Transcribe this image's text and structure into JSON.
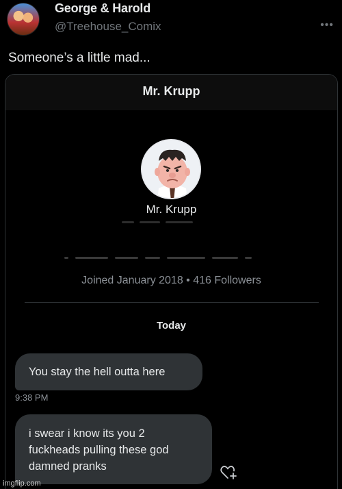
{
  "tweet": {
    "author_name": "George & Harold",
    "handle": "@Treehouse_Comix",
    "more_icon": "more-horizontal-icon",
    "text": "Someone’s a little mad..."
  },
  "card": {
    "title": "Mr. Krupp",
    "profile_name": "Mr. Krupp",
    "joined": "Joined January 2018 • 416 Followers",
    "date_header": "Today",
    "messages": [
      {
        "text": "You stay the hell outta here",
        "timestamp": "9:38 PM"
      },
      {
        "lines": [
          "i swear i know its you 2",
          "fuckheads pulling these god",
          "damned pranks"
        ]
      }
    ],
    "react_icon": "add-reaction-heart-icon"
  },
  "watermark": "imgflip.com",
  "colors": {
    "background": "#000000",
    "bubble": "#2f3336",
    "secondary_text": "#71767b"
  }
}
